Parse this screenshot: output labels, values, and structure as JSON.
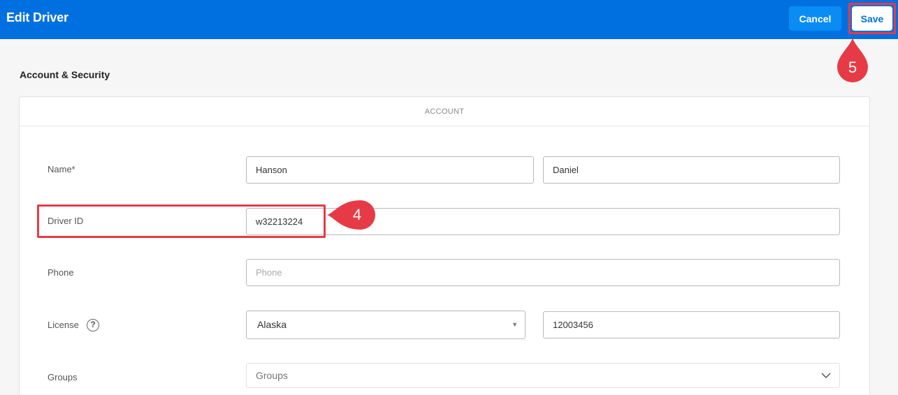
{
  "header": {
    "title": "Edit Driver",
    "cancel_label": "Cancel",
    "save_label": "Save"
  },
  "annotations": {
    "step_save": "5",
    "step_driver_id": "4"
  },
  "section": {
    "title": "Account & Security"
  },
  "card": {
    "header": "ACCOUNT"
  },
  "form": {
    "name": {
      "label": "Name*",
      "last_value": "Hanson",
      "first_value": "Daniel"
    },
    "driver_id": {
      "label": "Driver ID",
      "value": "w32213224"
    },
    "phone": {
      "label": "Phone",
      "placeholder": "Phone"
    },
    "license": {
      "label": "License",
      "help_icon": "?",
      "state_value": "Alaska",
      "number_value": "12003456"
    },
    "groups": {
      "label": "Groups",
      "placeholder": "Groups"
    }
  },
  "colors": {
    "header_bg": "#0070e0",
    "cancel_bg": "#0a8cf5",
    "highlight": "#e63b46"
  },
  "icons": {
    "state_dropdown": "caret-down-icon",
    "groups_dropdown": "chevron-down-icon",
    "license_help": "question-circle-icon"
  }
}
